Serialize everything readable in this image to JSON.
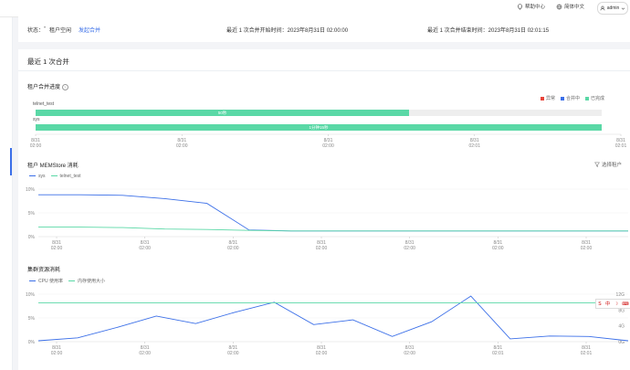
{
  "topbar": {
    "help": "帮助中心",
    "language": "简体中文",
    "user": "admin"
  },
  "status": {
    "state_label": "状态：",
    "state_value": "租户空闲",
    "action": "发起合并",
    "last_start": "最近 1 次合并开始时间：2023年8月31日 02:00:00",
    "last_end": "最近 1 次合并结束时间：2023年8月31日 02:01:15"
  },
  "main": {
    "title": "最近 1 次合并"
  },
  "progress": {
    "title": "租户合并进度",
    "legend": [
      "异常",
      "合并中",
      "已完成"
    ],
    "bars": [
      {
        "name": "telnet_test",
        "label": "50秒",
        "fraction": 0.66
      },
      {
        "name": "sys",
        "label": "1分钟15秒",
        "fraction": 1.0
      }
    ],
    "ticks": [
      "8/31\n02:00",
      "8/31\n02:00",
      "8/31\n02:00",
      "8/31\n02:01",
      "8/31\n02:01"
    ]
  },
  "memstore": {
    "title": "租户 MEMStore 消耗",
    "filter": "选择租户",
    "legend": [
      "sys",
      "telnet_test"
    ]
  },
  "cluster": {
    "title": "集群资源消耗",
    "legend": [
      "CPU 使用率",
      "内存使用大小"
    ]
  },
  "ime": {
    "lang": "中",
    "moon": "☽"
  },
  "colors": {
    "blue": "#3b6fe8",
    "green": "#5ad8a6",
    "red": "#e8453b",
    "link": "#3b6fe8"
  },
  "chart_data": [
    {
      "type": "bar",
      "title": "租户合并进度",
      "categories": [
        "telnet_test",
        "sys"
      ],
      "series": [
        {
          "name": "已完成",
          "values": [
            50,
            75
          ]
        }
      ],
      "data_labels": [
        "50秒",
        "1分钟15秒"
      ],
      "x_ticks": [
        "8/31 02:00",
        "8/31 02:00",
        "8/31 02:00",
        "8/31 02:01",
        "8/31 02:01"
      ]
    },
    {
      "type": "line",
      "title": "租户 MEMStore 消耗",
      "x": [
        0,
        1,
        2,
        3,
        4,
        5,
        6,
        7,
        8,
        9,
        10,
        11,
        12,
        13,
        14
      ],
      "x_ticks": [
        "8/31 02:00",
        "8/31 02:00",
        "8/31 02:00",
        "8/31 02:00",
        "8/31 02:00",
        "8/31 02:00",
        "8/31 02:00"
      ],
      "y_ticks": [
        "0%",
        "5%",
        "10%"
      ],
      "ylim": [
        0,
        10
      ],
      "series": [
        {
          "name": "sys",
          "values": [
            8.8,
            8.8,
            8.7,
            8.0,
            7.0,
            1.4,
            1.2,
            1.2,
            1.2,
            1.2,
            1.2,
            1.2,
            1.2,
            1.2,
            1.2
          ]
        },
        {
          "name": "telnet_test",
          "values": [
            2.0,
            2.0,
            1.9,
            1.6,
            1.5,
            1.3,
            1.2,
            1.2,
            1.2,
            1.2,
            1.2,
            1.2,
            1.2,
            1.2,
            1.2
          ]
        }
      ]
    },
    {
      "type": "line",
      "title": "集群资源消耗",
      "x": [
        0,
        1,
        2,
        3,
        4,
        5,
        6,
        7,
        8,
        9,
        10,
        11,
        12,
        13,
        14
      ],
      "x_ticks": [
        "8/31 02:00",
        "8/31 02:00",
        "8/31 02:00",
        "8/31 02:00",
        "8/31 02:00",
        "8/31 02:01",
        "8/31 02:01"
      ],
      "y_ticks_left": [
        "0%",
        "5%",
        "10%"
      ],
      "y_ticks_right": [
        "0G",
        "4G",
        "8G",
        "12G"
      ],
      "ylim": [
        0,
        10
      ],
      "series": [
        {
          "name": "CPU 使用率",
          "values": [
            0.2,
            0.8,
            3.0,
            5.4,
            3.8,
            6.2,
            8.3,
            3.6,
            4.6,
            1.1,
            4.2,
            9.6,
            0.6,
            1.2,
            1.1,
            0.2
          ]
        },
        {
          "name": "内存使用大小",
          "values": [
            8.2,
            8.2,
            8.2,
            8.2,
            8.2,
            8.2,
            8.2,
            8.2,
            8.2,
            8.2,
            8.2,
            8.2,
            8.2,
            8.2,
            8.2,
            8.2
          ]
        }
      ]
    }
  ]
}
